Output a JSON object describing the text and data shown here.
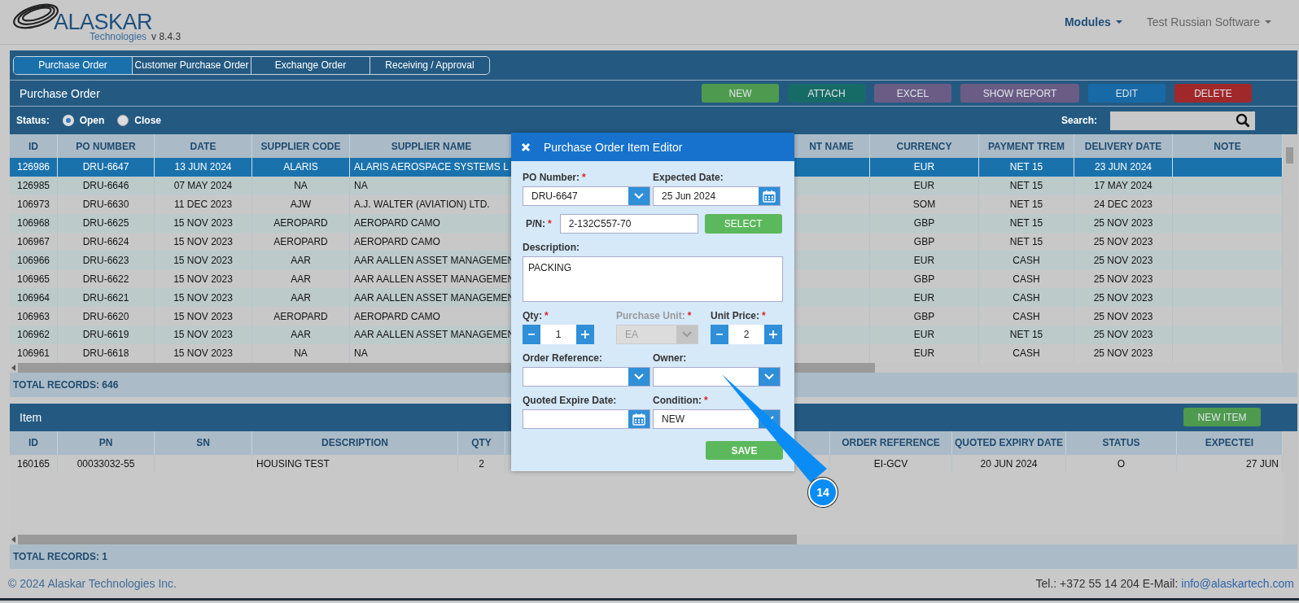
{
  "header": {
    "logo": "ALASKAR",
    "logo_sub": "Technologies",
    "version": "v 8.4.3",
    "menus": [
      {
        "label": "Modules",
        "active": true
      },
      {
        "label": "Test Russian Software",
        "active": false
      }
    ]
  },
  "tabs": [
    {
      "label": "Purchase Order",
      "selected": true
    },
    {
      "label": "Customer Purchase Order",
      "selected": false
    },
    {
      "label": "Exchange Order",
      "selected": false
    },
    {
      "label": "Receiving / Approval",
      "selected": false
    }
  ],
  "purchase_order": {
    "title": "Purchase Order",
    "buttons": [
      {
        "label": "NEW",
        "color": "#4e9a4e"
      },
      {
        "label": "ATTACH",
        "color": "#176b66"
      },
      {
        "label": "EXCEL",
        "color": "#6b5c86"
      },
      {
        "label": "SHOW REPORT",
        "color": "#6b5c86"
      },
      {
        "label": "EDIT",
        "color": "#176aa6"
      },
      {
        "label": "DELETE",
        "color": "#a1282a"
      }
    ],
    "status_label": "Status:",
    "status_options": [
      {
        "label": "Open",
        "selected": true
      },
      {
        "label": "Close",
        "selected": false
      }
    ],
    "search_label": "Search:",
    "table": {
      "columns": [
        "ID",
        "PO NUMBER",
        "DATE",
        "SUPPLIER CODE",
        "SUPPLIER NAME",
        "NT NAME",
        "CURRENCY",
        "PAYMENT TREM",
        "DELIVERY DATE",
        "NOTE"
      ],
      "rows": [
        {
          "selected": true,
          "cells": [
            "126986",
            "DRU-6647",
            "13 JUN 2024",
            "ALARIS",
            "ALARIS AEROSPACE SYSTEMS L",
            null,
            "EUR",
            "NET 15",
            "23 JUN 2024",
            null
          ]
        },
        {
          "selected": false,
          "cells": [
            "126985",
            "DRU-6646",
            "07 MAY 2024",
            "NA",
            "NA",
            null,
            "EUR",
            "NET 15",
            "17 MAY 2024",
            null
          ]
        },
        {
          "selected": false,
          "cells": [
            "106973",
            "DRU-6630",
            "11 DEC 2023",
            "AJW",
            "A.J. WALTER (AVIATION) LTD.",
            null,
            "SOM",
            "NET 15",
            "24 DEC 2023",
            null
          ]
        },
        {
          "selected": false,
          "cells": [
            "106968",
            "DRU-6625",
            "15 NOV 2023",
            "AEROPARD",
            "AEROPARD CAMO",
            null,
            "GBP",
            "NET 15",
            "25 NOV 2023",
            null
          ]
        },
        {
          "selected": false,
          "cells": [
            "106967",
            "DRU-6624",
            "15 NOV 2023",
            "AEROPARD",
            "AEROPARD CAMO",
            null,
            "GBP",
            "NET 15",
            "25 NOV 2023",
            null
          ]
        },
        {
          "selected": false,
          "cells": [
            "106966",
            "DRU-6623",
            "15 NOV 2023",
            "AAR",
            "AAR AALLEN ASSET MANAGEMEN",
            null,
            "EUR",
            "CASH",
            "25 NOV 2023",
            null
          ]
        },
        {
          "selected": false,
          "cells": [
            "106965",
            "DRU-6622",
            "15 NOV 2023",
            "AAR",
            "AAR AALLEN ASSET MANAGEMEN",
            null,
            "GBP",
            "CASH",
            "25 NOV 2023",
            null
          ]
        },
        {
          "selected": false,
          "cells": [
            "106964",
            "DRU-6621",
            "15 NOV 2023",
            "AAR",
            "AAR AALLEN ASSET MANAGEMEN",
            null,
            "EUR",
            "CASH",
            "25 NOV 2023",
            null
          ]
        },
        {
          "selected": false,
          "cells": [
            "106963",
            "DRU-6620",
            "15 NOV 2023",
            "AEROPARD",
            "AEROPARD CAMO",
            null,
            "GBP",
            "CASH",
            "25 NOV 2023",
            null
          ]
        },
        {
          "selected": false,
          "cells": [
            "106962",
            "DRU-6619",
            "15 NOV 2023",
            "AAR",
            "AAR AALLEN ASSET MANAGEMEN",
            null,
            "EUR",
            "NET 15",
            "25 NOV 2023",
            null
          ]
        },
        {
          "selected": false,
          "cells": [
            "106961",
            "DRU-6618",
            "15 NOV 2023",
            "NA",
            "NA",
            null,
            "EUR",
            "CASH",
            "25 NOV 2023",
            null
          ]
        }
      ]
    },
    "total": "TOTAL RECORDS: 646"
  },
  "item": {
    "title": "Item",
    "new_button": "NEW ITEM",
    "table": {
      "columns": [
        "ID",
        "PN",
        "SN",
        "DESCRIPTION",
        "QTY",
        "ORDER REFERENCE",
        "QUOTED EXPIRY DATE",
        "STATUS",
        "EXPECTEI"
      ],
      "rows": [
        {
          "selected": false,
          "cells": [
            "160165",
            "00033032-55",
            null,
            "HOUSING TEST",
            "2",
            "EI-GCV",
            "20 JUN 2024",
            "O",
            "27 JUN"
          ]
        }
      ]
    },
    "total": "TOTAL RECORDS: 1"
  },
  "editor": {
    "title": "Purchase Order Item Editor",
    "rows": [
      [
        {
          "kind": "select",
          "label": "PO Number:",
          "required_mark": "*",
          "value": "DRU-6647",
          "disabled": false
        },
        {
          "kind": "date",
          "label": "Expected Date:",
          "value": "25 Jun 2024",
          "disabled": false
        }
      ],
      [
        {
          "kind": "text_with_button",
          "label": "P/N:",
          "required_mark": "*",
          "value": "2-132C557-70",
          "button": "SELECT",
          "disabled": false
        }
      ],
      [
        {
          "kind": "textarea",
          "label": "Description:",
          "value": "PACKING",
          "disabled": false
        }
      ],
      [
        {
          "kind": "stepper",
          "label": "Qty:",
          "required_mark": "*",
          "value": "1",
          "disabled": false
        },
        {
          "kind": "select",
          "label": "Purchase Unit:",
          "required_mark": "*",
          "value": "EA",
          "disabled": true
        },
        {
          "kind": "stepper",
          "label": "Unit Price:",
          "required_mark": "*",
          "value": "2",
          "disabled": false
        }
      ],
      [
        {
          "kind": "select",
          "label": "Order Reference:",
          "disabled": false
        },
        {
          "kind": "select",
          "label": "Owner:",
          "disabled": false
        }
      ],
      [
        {
          "kind": "date",
          "label": "Quoted Expire Date:",
          "disabled": false
        },
        {
          "kind": "select",
          "label": "Condition:",
          "required_mark": "*",
          "value": "NEW",
          "disabled": false
        }
      ]
    ],
    "save_button": "SAVE"
  },
  "callout": {
    "number": "14"
  },
  "footer": {
    "copyright": "© 2024 Alaskar Technologies Inc.",
    "contact": "Tel.: +372 55 14 204 E-Mail:",
    "email": "info@alaskartech.com"
  }
}
